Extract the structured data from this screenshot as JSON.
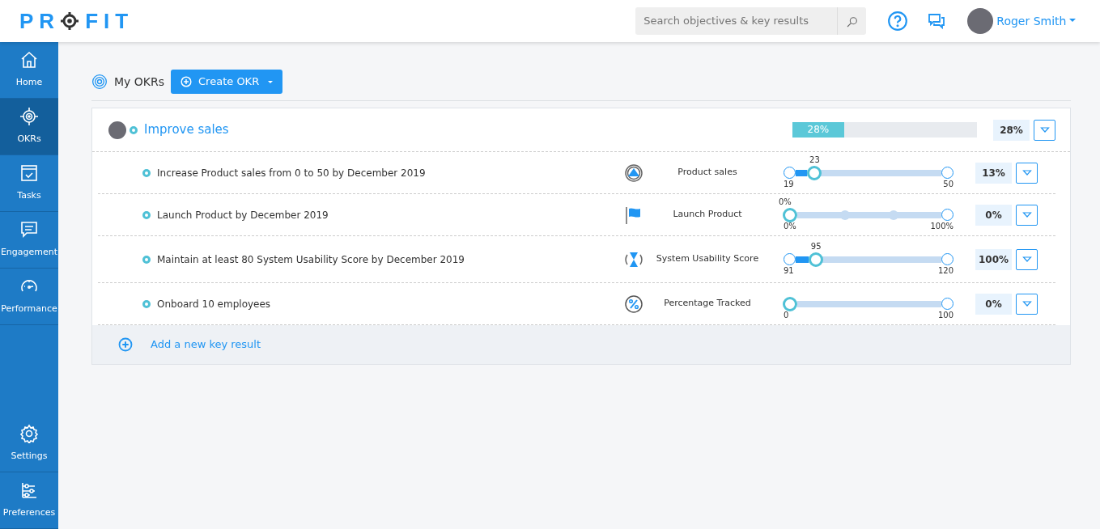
{
  "logo": {
    "before": "PR",
    "after": "FIT"
  },
  "search": {
    "placeholder": "Search objectives & key results"
  },
  "user": {
    "name": "Roger Smith"
  },
  "sidebar": {
    "items": [
      {
        "label": "Home",
        "kind": "home",
        "selected": false
      },
      {
        "label": "OKRs",
        "kind": "okrs",
        "selected": true
      },
      {
        "label": "Tasks",
        "kind": "tasks",
        "selected": false
      },
      {
        "label": "Engagement",
        "kind": "engagement",
        "selected": false
      },
      {
        "label": "Performance",
        "kind": "performance",
        "selected": false
      }
    ],
    "bottom_items": [
      {
        "label": "Settings",
        "kind": "settings",
        "selected": false
      },
      {
        "label": "Preferences",
        "kind": "preferences",
        "selected": false
      }
    ]
  },
  "header": {
    "title": "My OKRs",
    "create_button": "Create OKR"
  },
  "objective": {
    "title": "Improve sales",
    "level": 0.28,
    "progress_label": "28%",
    "percent": "28%"
  },
  "key_results": [
    {
      "title": "Increase Product sales from 0 to 50 by December 2019",
      "kind": "increase",
      "metric": "Product sales",
      "level": 0.13,
      "current": "23",
      "start": "19",
      "end": "50",
      "percent": "13%"
    },
    {
      "title": "Launch Product by December 2019",
      "kind": "milestone",
      "metric": "Launch Product",
      "level": 0,
      "current": "0%",
      "start": "0%",
      "end": "100%",
      "percent": "0%"
    },
    {
      "title": "Maintain at least 80 System Usability Score by December 2019",
      "kind": "maintain",
      "metric": "System Usability Score",
      "level": 0.14,
      "current": "95",
      "start": "91",
      "end": "120",
      "percent": "100%"
    },
    {
      "title": "Onboard 10 employees",
      "kind": "percentage",
      "metric": "Percentage Tracked",
      "level": 0,
      "start": "0",
      "end": "100",
      "percent": "0%"
    }
  ],
  "add_key_result": "Add a new key result"
}
